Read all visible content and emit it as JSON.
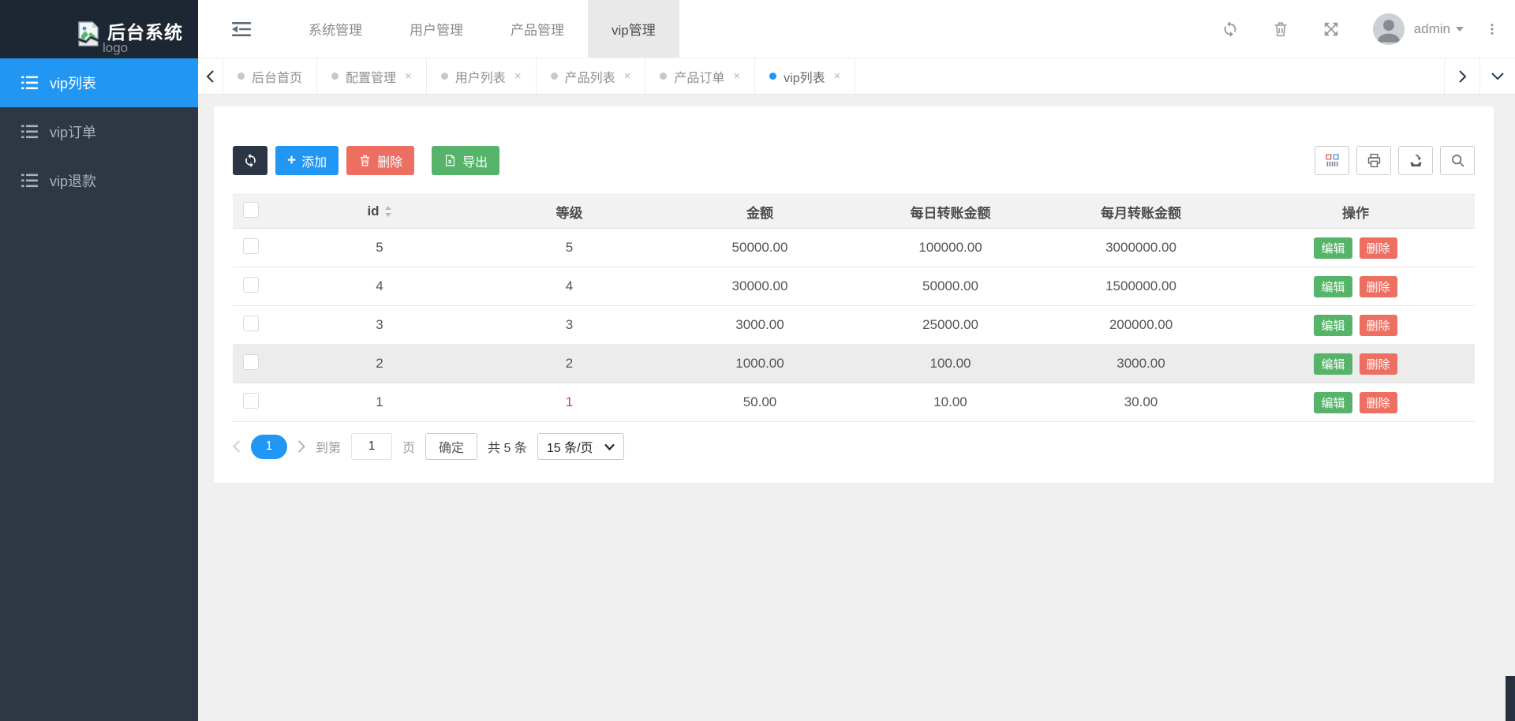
{
  "brand": {
    "logo_alt": "logo",
    "title": "后台系统"
  },
  "nav": {
    "items": [
      {
        "label": "系统管理"
      },
      {
        "label": "用户管理"
      },
      {
        "label": "产品管理"
      },
      {
        "label": "vip管理",
        "active": true
      }
    ]
  },
  "user": {
    "name": "admin"
  },
  "tabs": {
    "close_glyph": "×",
    "items": [
      {
        "label": "后台首页",
        "closable": false
      },
      {
        "label": "配置管理",
        "closable": true
      },
      {
        "label": "用户列表",
        "closable": true
      },
      {
        "label": "产品列表",
        "closable": true
      },
      {
        "label": "产品订单",
        "closable": true
      },
      {
        "label": "vip列表",
        "closable": true,
        "active": true
      }
    ]
  },
  "sidebar": {
    "items": [
      {
        "label": "vip列表",
        "active": true
      },
      {
        "label": "vip订单"
      },
      {
        "label": "vip退款"
      }
    ]
  },
  "toolbar": {
    "add_label": "添加",
    "delete_label": "删除",
    "export_label": "导出"
  },
  "table": {
    "columns": {
      "id": "id",
      "level": "等级",
      "amount": "金额",
      "daily": "每日转账金额",
      "monthly": "每月转账金额",
      "actions": "操作"
    },
    "edit_label": "编辑",
    "delete_label": "删除",
    "rows": [
      {
        "id": "5",
        "level": "5",
        "amount": "50000.00",
        "daily": "100000.00",
        "monthly": "3000000.00"
      },
      {
        "id": "4",
        "level": "4",
        "amount": "30000.00",
        "daily": "50000.00",
        "monthly": "1500000.00"
      },
      {
        "id": "3",
        "level": "3",
        "amount": "3000.00",
        "daily": "25000.00",
        "monthly": "200000.00"
      },
      {
        "id": "2",
        "level": "2",
        "amount": "1000.00",
        "daily": "100.00",
        "monthly": "3000.00"
      },
      {
        "id": "1",
        "level": "1",
        "amount": "50.00",
        "daily": "10.00",
        "monthly": "30.00"
      }
    ]
  },
  "pagination": {
    "current_page": "1",
    "goto_label": "到第",
    "goto_value": "1",
    "page_unit": "页",
    "confirm_label": "确定",
    "total_label": "共 5 条",
    "page_size": "15 条/页"
  },
  "colors": {
    "accent_blue": "#2196f3",
    "danger_red": "#ec6f62",
    "success_green": "#55b469",
    "dark_navy": "#2c3543"
  }
}
